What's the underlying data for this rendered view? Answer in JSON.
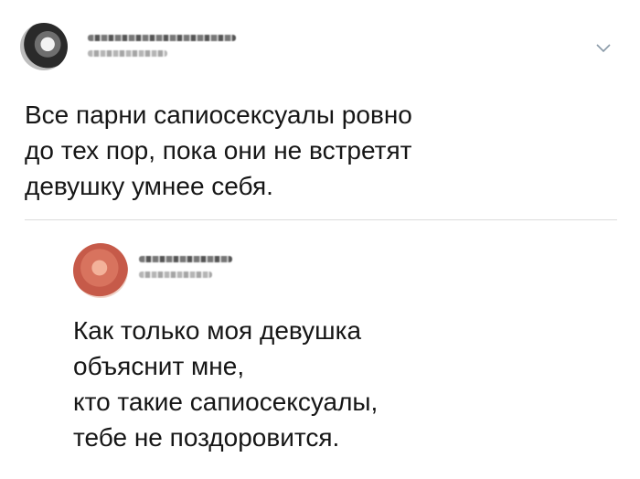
{
  "tweet": {
    "author_name": "",
    "author_handle": "",
    "menu_icon": "chevron-down-icon",
    "text": "Все парни сапиосексуалы ровно\nдо тех пор, пока они не встретят\nдевушку умнее себя."
  },
  "reply": {
    "author_name": "",
    "author_handle": "",
    "text": "Как только моя девушка\nобъяснит мне,\nкто такие сапиосексуалы,\nтебе не поздоровится."
  },
  "colors": {
    "background": "#ffffff",
    "text": "#161616",
    "divider": "#dcdcdc",
    "chevron": "#8a9aa8"
  }
}
